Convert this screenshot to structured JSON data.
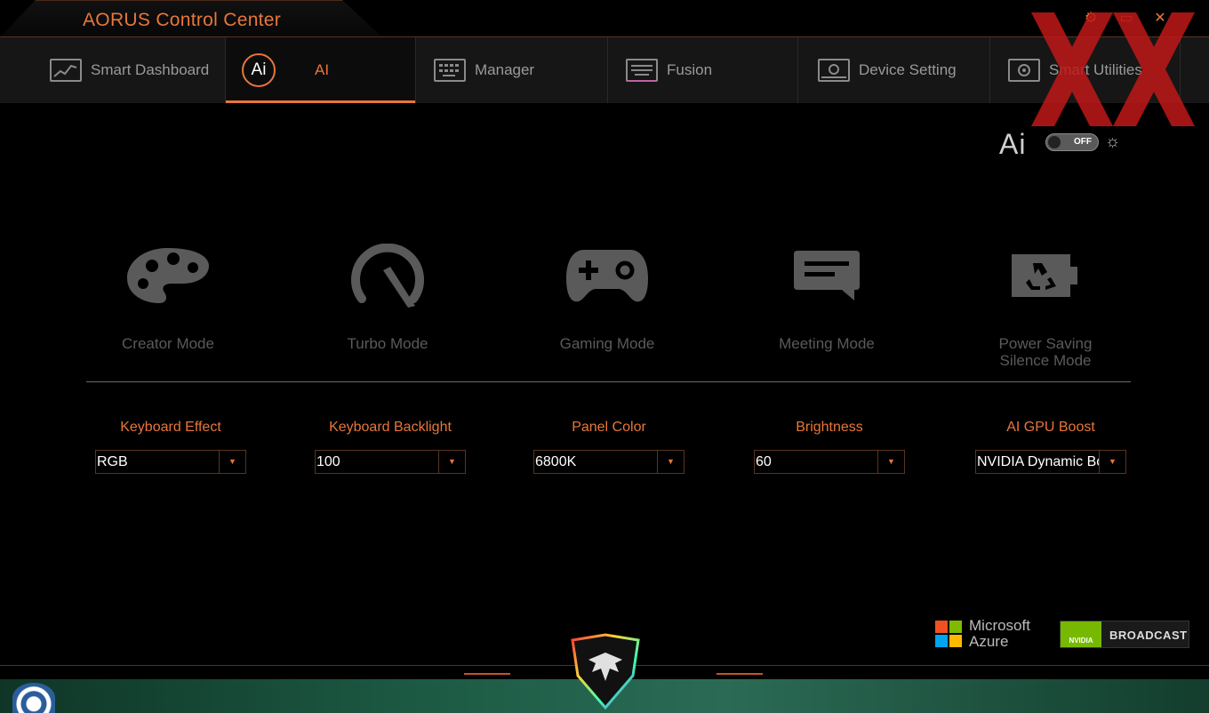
{
  "window": {
    "title": "AORUS Control Center"
  },
  "tabs": [
    {
      "label": "Smart Dashboard",
      "icon": "dashboard-icon",
      "active": false
    },
    {
      "label": "AI",
      "icon": "ai-icon",
      "active": true
    },
    {
      "label": "Manager",
      "icon": "manager-icon",
      "active": false
    },
    {
      "label": "Fusion",
      "icon": "keyboard-rgb-icon",
      "active": false
    },
    {
      "label": "Device Setting",
      "icon": "laptop-icon",
      "active": false
    },
    {
      "label": "Smart Utilities",
      "icon": "utilities-icon",
      "active": false
    }
  ],
  "ai_toggle": {
    "logo": "Ai",
    "state": "OFF"
  },
  "modes": [
    {
      "label": "Creator Mode",
      "icon": "palette-icon"
    },
    {
      "label": "Turbo Mode",
      "icon": "speedometer-icon"
    },
    {
      "label": "Gaming Mode",
      "icon": "gamepad-icon"
    },
    {
      "label": "Meeting Mode",
      "icon": "chat-icon"
    },
    {
      "label_line1": "Power Saving",
      "label_line2": "Silence Mode",
      "icon": "battery-recycle-icon"
    }
  ],
  "settings": [
    {
      "label": "Keyboard Effect",
      "value": "RGB"
    },
    {
      "label": "Keyboard Backlight",
      "value": "100"
    },
    {
      "label": "Panel Color",
      "value": "6800K"
    },
    {
      "label": "Brightness",
      "value": "60"
    },
    {
      "label": "AI GPU Boost",
      "value": "NVIDIA Dynamic Boost"
    }
  ],
  "partners": {
    "microsoft_line1": "Microsoft",
    "microsoft_line2": "Azure",
    "nvidia_text": "BROADCAST",
    "nvidia_small": "NVIDIA"
  },
  "colors": {
    "accent": "#e8763a",
    "background": "#000000",
    "muted": "#5a5a5a"
  }
}
